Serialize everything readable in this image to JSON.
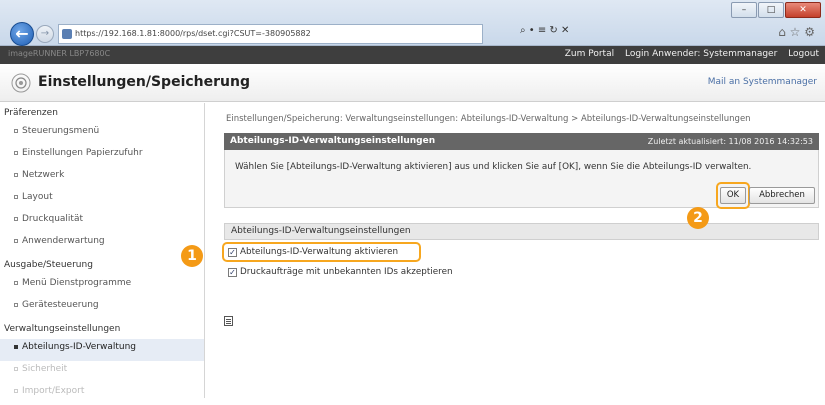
{
  "browser": {
    "url": "https://192.168.1.81:8000/rps/dset.cgi?CSUT=-380905882",
    "tools": "⌕ • ≡ ↻ ✕",
    "favicons": "⌂ ☆ ⚙",
    "window": {
      "minimize": "–",
      "maximize": "□",
      "close": "✕"
    },
    "back": "←",
    "forward": "→"
  },
  "header": {
    "brand": "imageRUNNER  LBP7680C",
    "links": [
      "Zum Portal",
      "Login Anwender: Systemmanager",
      "Logout"
    ]
  },
  "title": {
    "text": "Einstellungen/Speicherung",
    "mail": "Mail an Systemmanager"
  },
  "sidebar": {
    "groups": [
      {
        "label": "Präferenzen",
        "items": [
          "Steuerungsmenü",
          "Einstellungen Papierzufuhr",
          "Netzwerk",
          "Layout",
          "Druckqualität",
          "Anwenderwartung"
        ]
      },
      {
        "label": "Ausgabe/Steuerung",
        "items": [
          "Menü Dienstprogramme",
          "Gerätesteuerung"
        ]
      },
      {
        "label": "Verwaltungseinstellungen",
        "items": [
          "Abteilungs-ID-Verwaltung",
          "Sicherheit",
          "Import/Export"
        ]
      }
    ]
  },
  "main": {
    "breadcrumb": "Einstellungen/Speicherung: Verwaltungseinstellungen: Abteilungs-ID-Verwaltung > Abteilungs-ID-Verwaltungseinstellungen",
    "panel_title": "Abteilungs-ID-Verwaltungseinstellungen",
    "updated": "Zuletzt aktualisiert: 11/08 2016 14:32:53",
    "message": "Wählen Sie [Abteilungs-ID-Verwaltung aktivieren] aus und klicken Sie auf [OK], wenn Sie die Abteilungs-ID verwalten.",
    "ok_label": "OK",
    "cancel_label": "Abbrechen",
    "section_title": "Abteilungs-ID-Verwaltungseinstellungen",
    "checkbox1_label": "Abteilungs-ID-Verwaltung aktivieren",
    "checkbox2_label": "Druckaufträge mit unbekannten IDs akzeptieren",
    "checkbox1_checked": true,
    "checkbox2_checked": true
  },
  "callouts": {
    "one": "1",
    "two": "2"
  },
  "colors": {
    "accent": "#f49a16",
    "header": "#3e3e3e",
    "panel": "#666666"
  }
}
